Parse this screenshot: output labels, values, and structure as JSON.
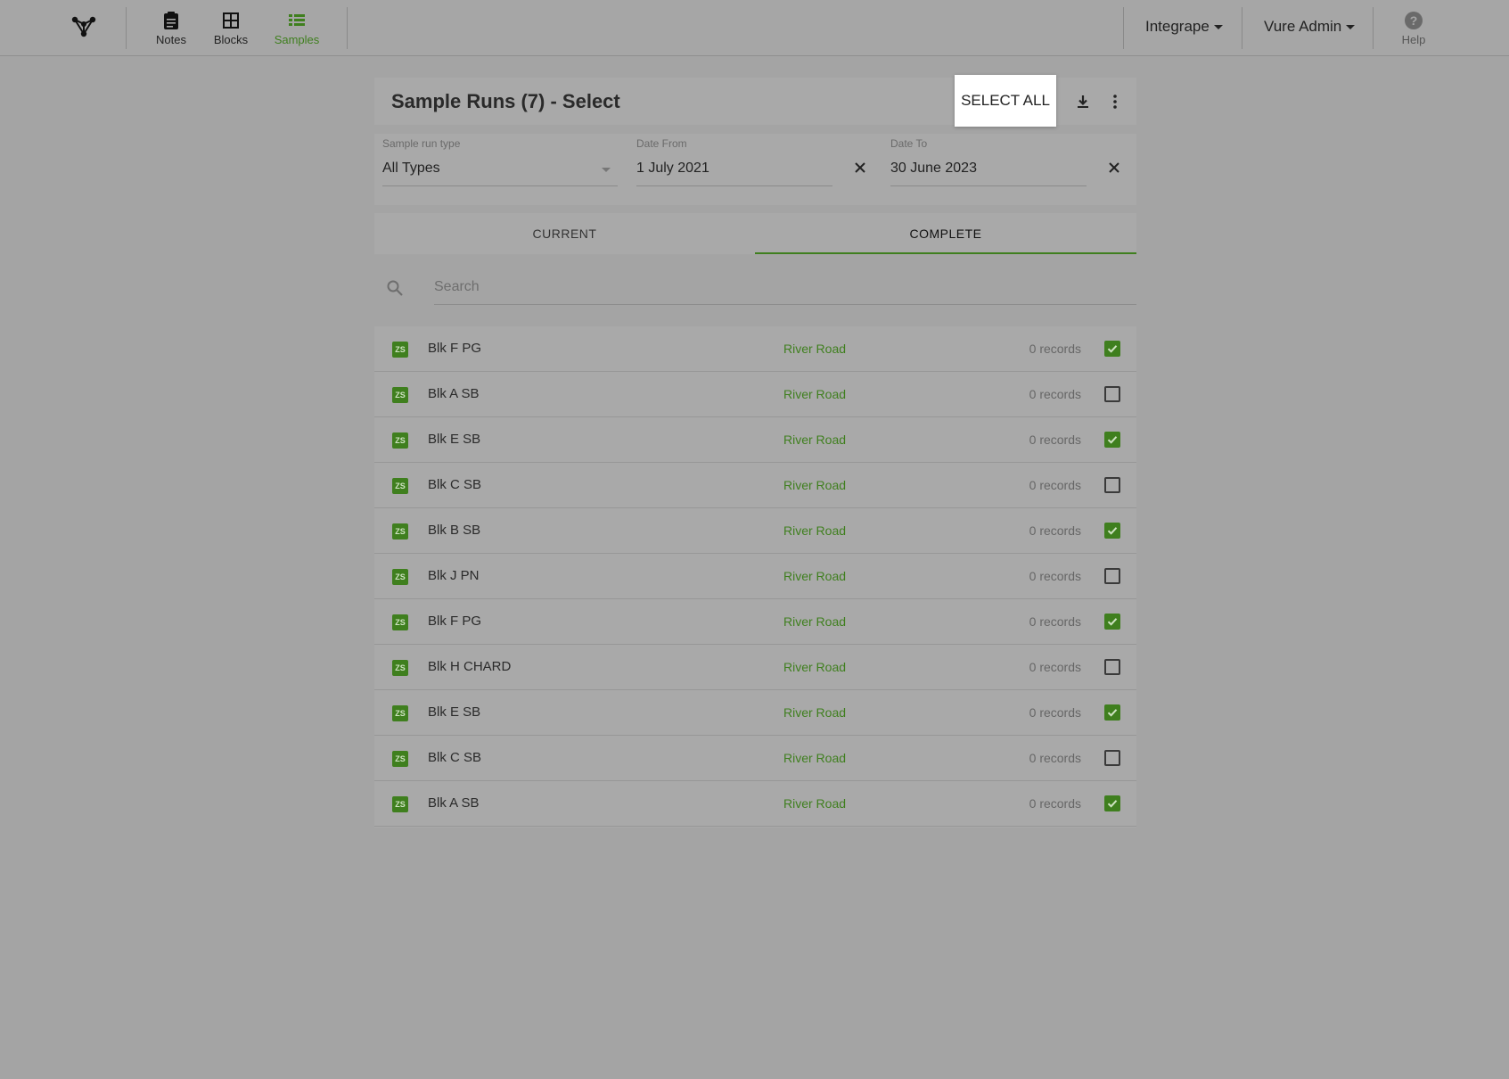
{
  "nav": {
    "items": [
      {
        "label": "Notes",
        "icon": "clipboard-icon",
        "active": false
      },
      {
        "label": "Blocks",
        "icon": "grid-icon",
        "active": false
      },
      {
        "label": "Samples",
        "icon": "list-icon",
        "active": true
      }
    ],
    "org_menu": "Integrape",
    "user_menu": "Vure Admin",
    "help_label": "Help"
  },
  "header": {
    "title": "Sample Runs (7) - Select",
    "select_all_label": "SELECT ALL"
  },
  "filters": {
    "type_label": "Sample run type",
    "type_value": "All Types",
    "from_label": "Date From",
    "from_value": "1 July 2021",
    "to_label": "Date To",
    "to_value": "30 June 2023"
  },
  "tabs": [
    {
      "label": "CURRENT",
      "active": false
    },
    {
      "label": "COMPLETE",
      "active": true
    }
  ],
  "search": {
    "placeholder": "Search"
  },
  "rows": [
    {
      "badge": "ZS",
      "name": "Blk F PG",
      "location": "River Road",
      "records": "0 records",
      "checked": true
    },
    {
      "badge": "ZS",
      "name": "Blk A SB",
      "location": "River Road",
      "records": "0 records",
      "checked": false
    },
    {
      "badge": "ZS",
      "name": "Blk E SB",
      "location": "River Road",
      "records": "0 records",
      "checked": true
    },
    {
      "badge": "ZS",
      "name": "Blk C SB",
      "location": "River Road",
      "records": "0 records",
      "checked": false
    },
    {
      "badge": "ZS",
      "name": "Blk B SB",
      "location": "River Road",
      "records": "0 records",
      "checked": true
    },
    {
      "badge": "ZS",
      "name": "Blk J PN",
      "location": "River Road",
      "records": "0 records",
      "checked": false
    },
    {
      "badge": "ZS",
      "name": "Blk F PG",
      "location": "River Road",
      "records": "0 records",
      "checked": true
    },
    {
      "badge": "ZS",
      "name": "Blk H CHARD",
      "location": "River Road",
      "records": "0 records",
      "checked": false
    },
    {
      "badge": "ZS",
      "name": "Blk E SB",
      "location": "River Road",
      "records": "0 records",
      "checked": true
    },
    {
      "badge": "ZS",
      "name": "Blk C SB",
      "location": "River Road",
      "records": "0 records",
      "checked": false
    },
    {
      "badge": "ZS",
      "name": "Blk A SB",
      "location": "River Road",
      "records": "0 records",
      "checked": true
    }
  ],
  "colors": {
    "accent": "#3f7f1e",
    "background": "#a4a4a4",
    "highlight": "#ffffff"
  }
}
